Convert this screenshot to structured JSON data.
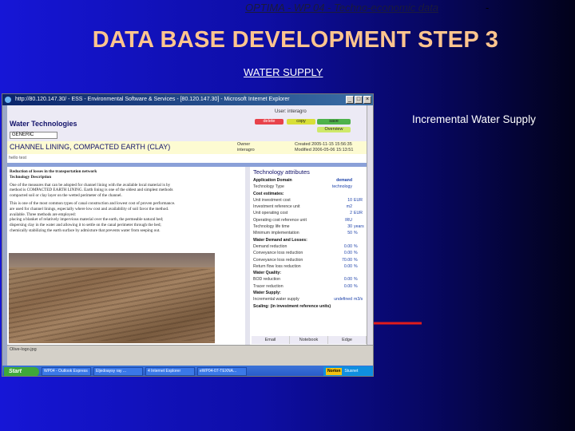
{
  "slide": {
    "header_text": "OPTIMA - WP 04 - Techno-economic data",
    "header_mark": "-",
    "title": "DATA BASE DEVELOPMENT STEP 3",
    "subtitle": "WATER SUPPLY",
    "callout": "Incremental Water Supply",
    "arrow_color": "#e01c1c"
  },
  "browser": {
    "title": "http://80.120.147.30/ - ESS - Environmental Software & Services - [80.120.147.30] - Microsoft Internet Explorer",
    "status": "Olive-logo.jpg",
    "app": {
      "name": "Water Technologies",
      "user": "User: interagro",
      "buttons": {
        "delete": "delete",
        "copy": "copy",
        "save": "save",
        "overview": "Overview"
      },
      "selector": "GENERIC",
      "item_name": "CHANNEL LINING, COMPACTED EARTH (CLAY)",
      "owner_label": "Owner",
      "owner": "interagro",
      "created": "Created 2005-11-15 15:56:35",
      "modified": "Modified 2006-05-06 15:13:51",
      "comment": "hello test",
      "description_lines": [
        "Reduction of losses in the transportation network",
        "Technology Description",
        "One of the measures that can be adopted for channel lining with the available local material is by",
        "method is COMPACTED EARTH LINING. Earth lining is one of the oldest and simplest methods",
        "compacted soil or clay layer on the wetted perimeter of the channel.",
        "This is one of the most common types of canal construction and lowest cost of proven performance.",
        "are used for channel linings, especially where low cost and availability of soil favor the method.",
        "available. Three methods are employed:",
        "  placing a blanket of relatively impervious material over the earth, the permeable natural bed;",
        "  dispersing clay in the water and allowing it to settle on the canal perimeter through the bed;",
        "  chemically stabilizing the earth surface by admixture that prevents water from seeping out."
      ],
      "attributes": {
        "heading": "Technology attributes",
        "rows": [
          {
            "label": "Application Domain",
            "value": "demand",
            "unit": "",
            "header": true
          },
          {
            "label": "Technology Type",
            "value": "technology",
            "unit": "",
            "header": false
          },
          {
            "label": "Cost estimates:",
            "value": "",
            "unit": "",
            "header": true
          },
          {
            "label": "Unit investment cost",
            "value": "10",
            "unit": "EUR",
            "header": false
          },
          {
            "label": "Investment reference unit",
            "value": "m2",
            "unit": "",
            "header": false
          },
          {
            "label": "Unit operating cost",
            "value": "2",
            "unit": "EUR",
            "header": false
          },
          {
            "label": "Operating cost reference unit",
            "value": "IRU",
            "unit": "",
            "header": false
          },
          {
            "label": "Technology life time",
            "value": "30",
            "unit": "years",
            "header": false
          },
          {
            "label": "Minimum implementation",
            "value": "50",
            "unit": "%",
            "header": false
          },
          {
            "label": "Water Demand and Losses:",
            "value": "",
            "unit": "",
            "header": true
          },
          {
            "label": "Demand reduction",
            "value": "0.00",
            "unit": "%",
            "header": false
          },
          {
            "label": "Conveyance loss reduction",
            "value": "0.00",
            "unit": "%",
            "header": false
          },
          {
            "label": "Conveyance loss reduction",
            "value": "70.00",
            "unit": "%",
            "header": false
          },
          {
            "label": "Return flow loss reduction",
            "value": "0.00",
            "unit": "%",
            "header": false
          },
          {
            "label": "Water Quality:",
            "value": "",
            "unit": "",
            "header": true
          },
          {
            "label": "BOD reduction",
            "value": "0.00",
            "unit": "%",
            "header": false
          },
          {
            "label": "Tracer reduction",
            "value": "0.00",
            "unit": "%",
            "header": false
          },
          {
            "label": "Water Supply:",
            "value": "",
            "unit": "",
            "header": true
          },
          {
            "label": "Incremental water supply",
            "value": "undefined",
            "unit": "m3/s",
            "header": false
          },
          {
            "label": "Scaling: (in investment reference units)",
            "value": "",
            "unit": "",
            "header": true
          }
        ]
      },
      "bottom_buttons": [
        "Email",
        "Notebook",
        "Edge"
      ]
    },
    "taskbar": {
      "start": "Start",
      "items": [
        "WP04 - Outlook Express",
        "Eljedoaysy ray ...",
        "4 Internet Explorer",
        "eWP04-07-TΕΧΝΑ..."
      ],
      "norton": "Norton",
      "clock": "Stuxnet"
    }
  }
}
